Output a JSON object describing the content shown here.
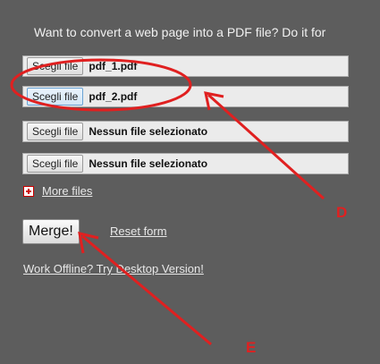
{
  "intro_text": "Want to convert a web page into a PDF file? Do it for",
  "files": [
    {
      "button": "Scegli file",
      "name": "pdf_1.pdf"
    },
    {
      "button": "Scegli file",
      "name": "pdf_2.pdf"
    },
    {
      "button": "Scegli file",
      "name": "Nessun file selezionato"
    },
    {
      "button": "Scegli file",
      "name": "Nessun file selezionato"
    }
  ],
  "more_files_label": "More files",
  "merge_label": "Merge!",
  "reset_label": "Reset form",
  "offline_label": "Work Offline? Try Desktop Version!",
  "annotations": {
    "d": "D",
    "e": "E"
  },
  "colors": {
    "annotation": "#e02020",
    "background": "#5d5d5d"
  }
}
